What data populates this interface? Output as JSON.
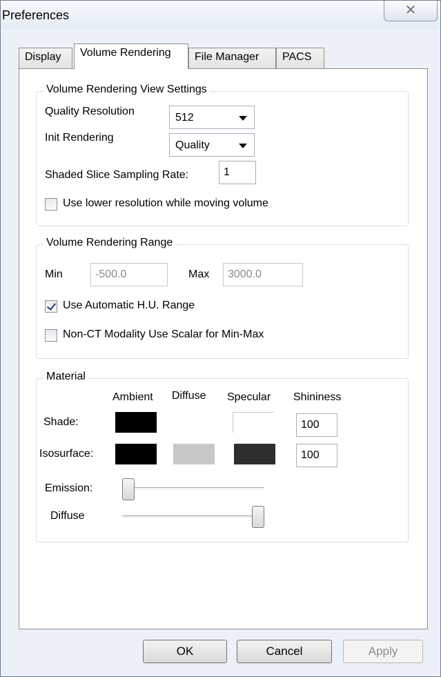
{
  "window": {
    "title": "Preferences",
    "close_glyph": "✕"
  },
  "tabs": [
    {
      "label": "Display"
    },
    {
      "label": "Volume Rendering",
      "active": true
    },
    {
      "label": "File Manager"
    },
    {
      "label": "PACS"
    }
  ],
  "view_settings": {
    "legend": "Volume Rendering View Settings",
    "quality_resolution_label": "Quality Resolution",
    "quality_resolution_value": "512",
    "init_rendering_label": "Init Rendering",
    "init_rendering_value": "Quality",
    "sampling_rate_label": "Shaded Slice Sampling Rate:",
    "sampling_rate_value": "1",
    "lower_res_label": "Use lower resolution while moving volume",
    "lower_res_checked": false
  },
  "range": {
    "legend": "Volume Rendering Range",
    "min_label": "Min",
    "min_value": "-500.0",
    "max_label": "Max",
    "max_value": "3000.0",
    "auto_hu_label": "Use Automatic H.U. Range",
    "auto_hu_checked": true,
    "non_ct_label": "Non-CT Modality Use Scalar for Min-Max",
    "non_ct_checked": false
  },
  "material": {
    "legend": "Material",
    "col_ambient": "Ambient",
    "col_diffuse": "Diffuse",
    "col_specular": "Specular",
    "col_shininess": "Shininess",
    "shade_label": "Shade:",
    "shade_shininess": "100",
    "iso_label": "Isosurface:",
    "iso_shininess": "100",
    "emission_label": "Emission:",
    "emission_level": 0,
    "diffuse_label": "Diffuse",
    "diffuse_level": 1,
    "colors": {
      "shade_ambient": "#000000",
      "shade_specular": "#ffffff",
      "iso_ambient": "#000000",
      "iso_diffuse": "#c8c8c8",
      "iso_specular": "#2e2e2e"
    }
  },
  "buttons": {
    "ok": "OK",
    "cancel": "Cancel",
    "apply": "Apply"
  }
}
